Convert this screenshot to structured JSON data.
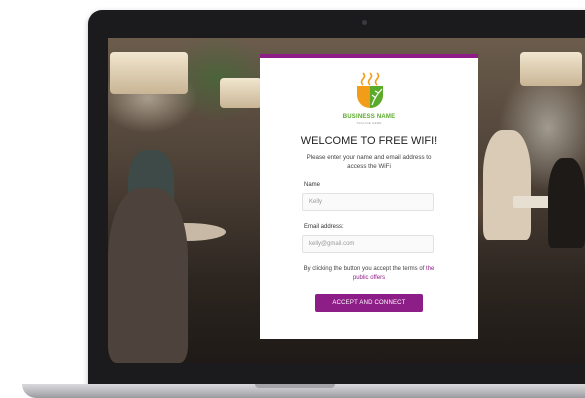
{
  "brand": {
    "name": "BUSINESS NAME",
    "tagline": "TAGLINE HERE",
    "logo_icon": "coffee-leaf-logo",
    "colors": {
      "green": "#5aaa2b",
      "orange": "#f29d1a",
      "purple": "#8e1e87"
    }
  },
  "portal": {
    "title": "WELCOME TO FREE WIFI!",
    "subtitle": "Please enter your name and email address to access the WiFi"
  },
  "form": {
    "name": {
      "label": "Name",
      "value": "Kelly"
    },
    "email": {
      "label": "Email address:",
      "value": "kelly@gmail.com"
    }
  },
  "terms": {
    "text": "By clicking the button you accept the terms of",
    "link": "the public offers"
  },
  "cta": {
    "label": "ACCEPT AND CONNECT"
  }
}
